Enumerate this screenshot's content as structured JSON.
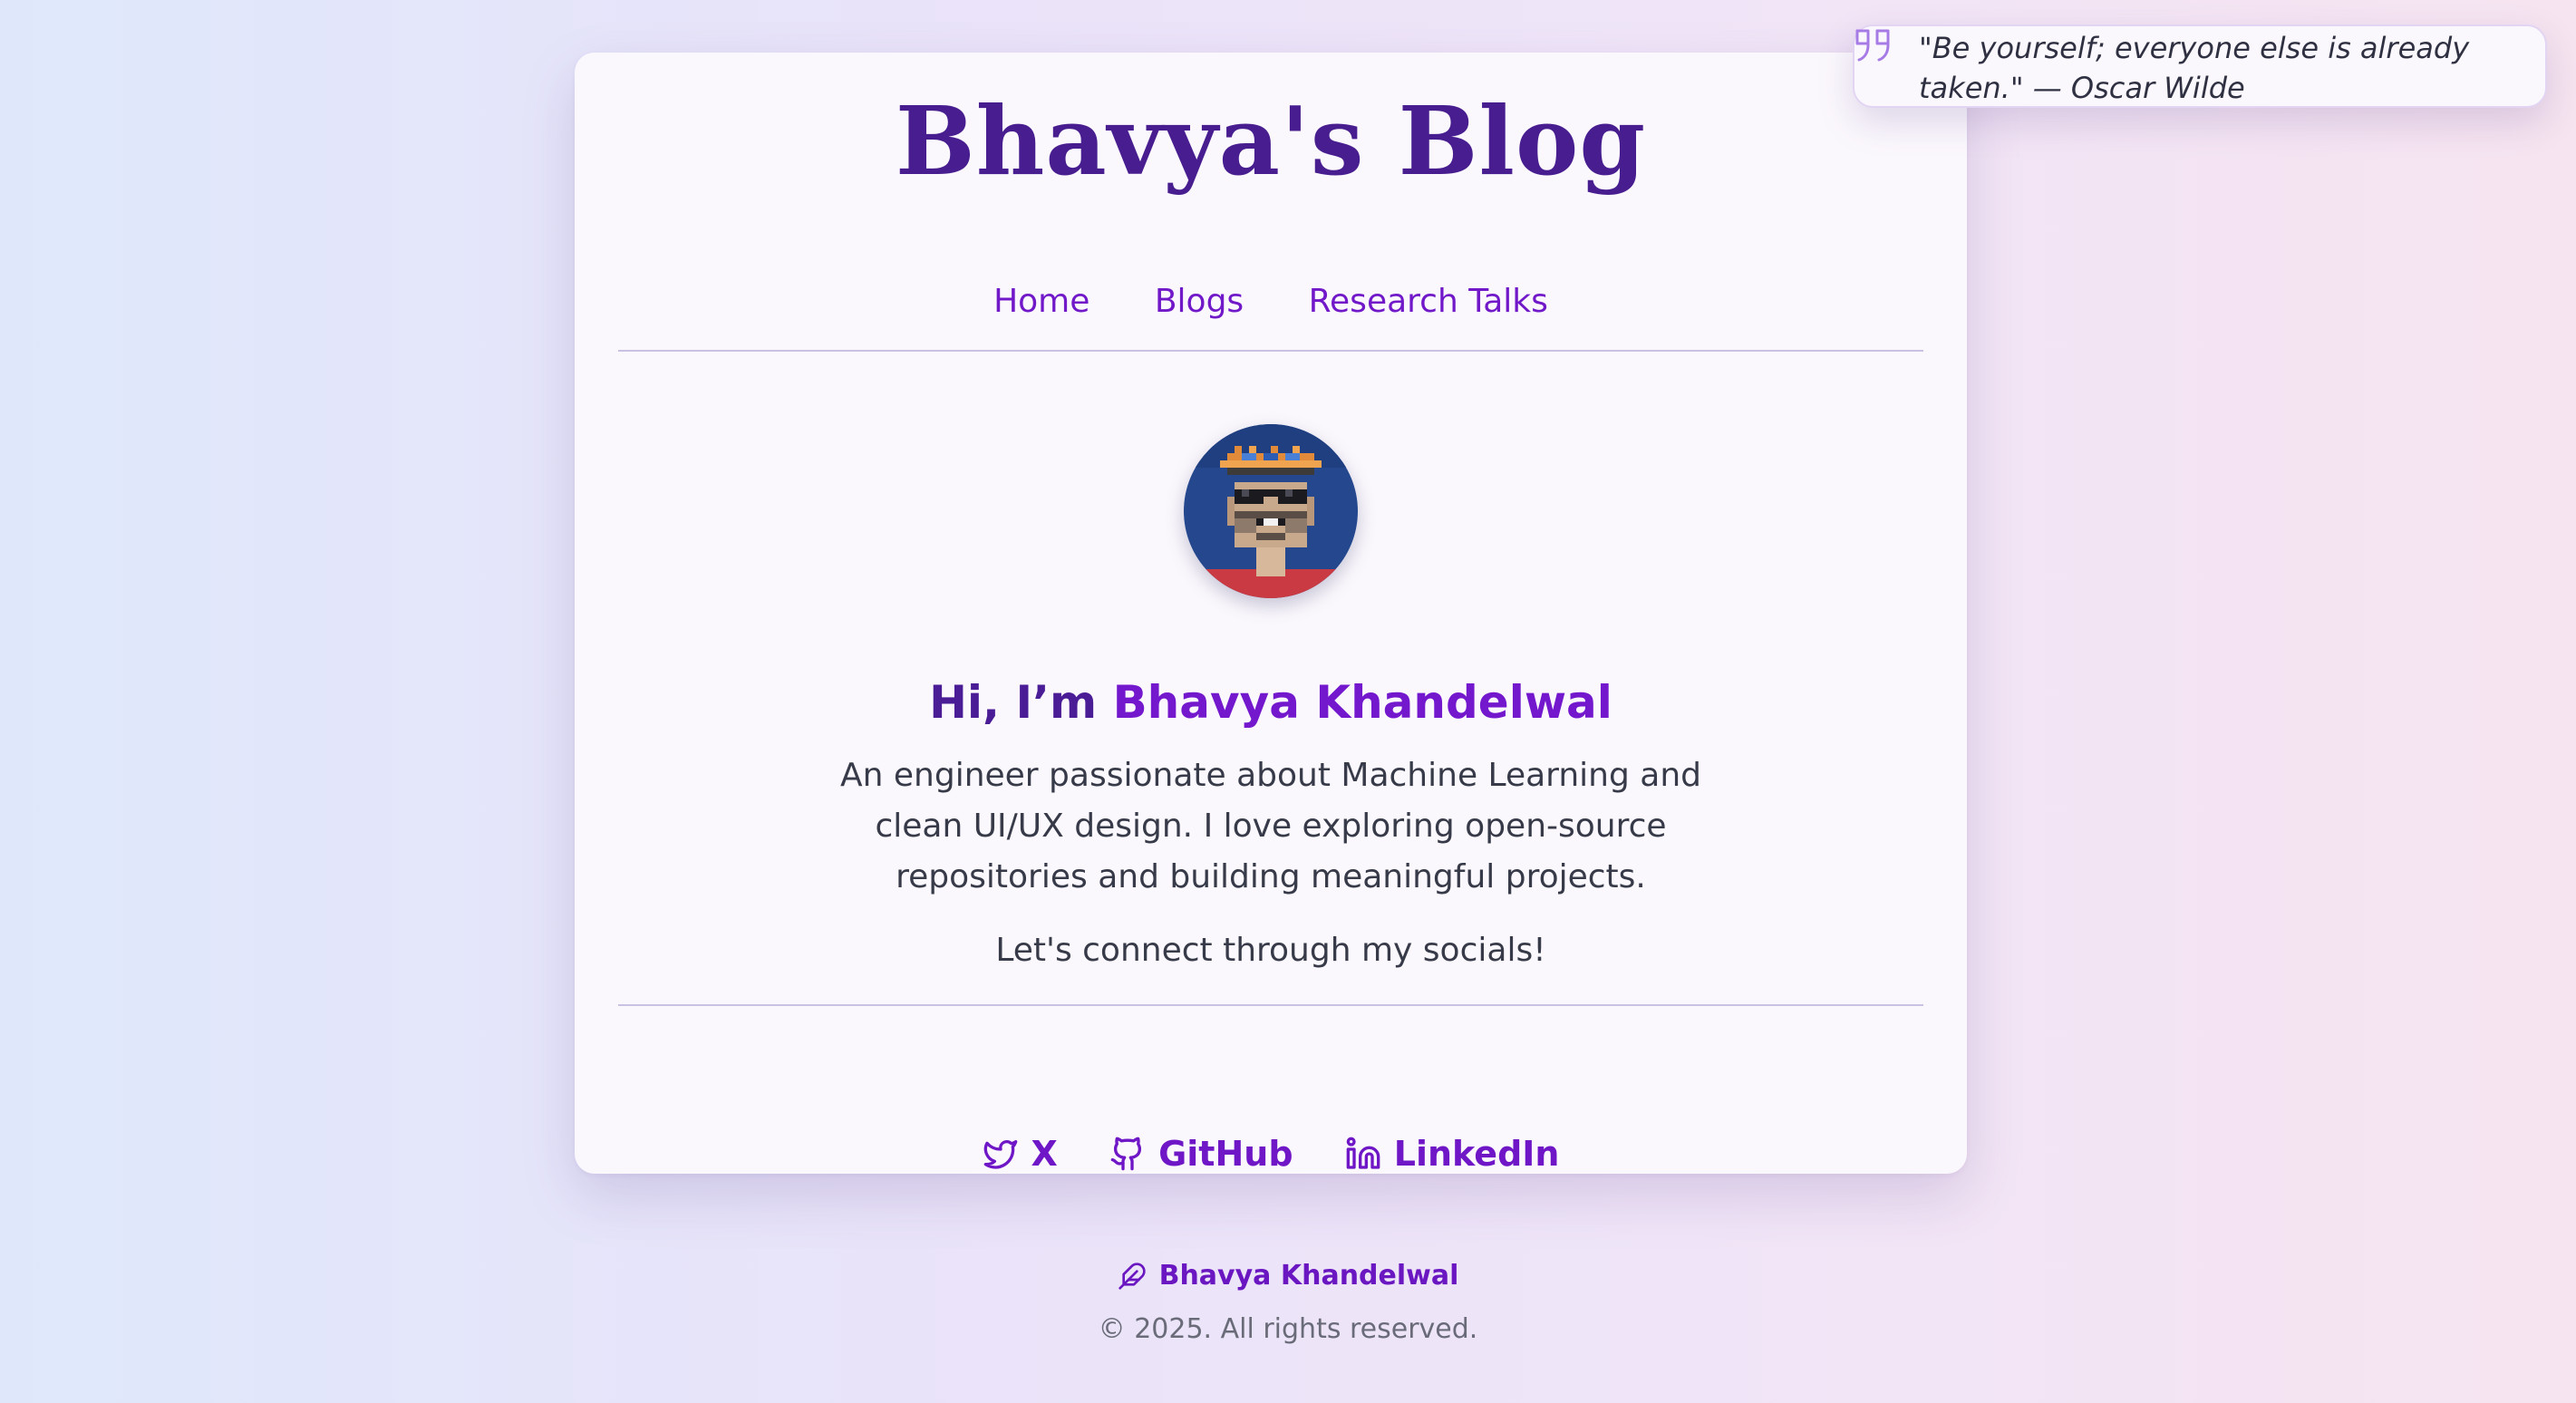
{
  "header": {
    "title": "Bhavya's Blog",
    "nav": [
      {
        "label": "Home"
      },
      {
        "label": "Blogs"
      },
      {
        "label": "Research Talks"
      }
    ]
  },
  "profile": {
    "avatar_icon": "pixel-avatar",
    "greeting_prefix": "Hi, I’m ",
    "name": "Bhavya Khandelwal",
    "bio": "An engineer passionate about Machine Learning and clean UI/UX design. I love exploring open-source repositories and building meaningful projects.",
    "connect": "Let's connect through my socials!"
  },
  "socials": [
    {
      "label": "X",
      "icon": "twitter-bird-icon"
    },
    {
      "label": "GitHub",
      "icon": "github-icon"
    },
    {
      "label": "LinkedIn",
      "icon": "linkedin-icon"
    }
  ],
  "quote": {
    "icon": "quote-icon",
    "text": "\"Be yourself; everyone else is already taken.\" — Oscar Wilde"
  },
  "footer": {
    "name": "Bhavya Khandelwal",
    "icon": "feather-icon",
    "copyright": "© 2025. All rights reserved."
  },
  "colors": {
    "accent": "#7318cd",
    "title": "#471d8f",
    "card_bg": "#fbf8fd"
  }
}
